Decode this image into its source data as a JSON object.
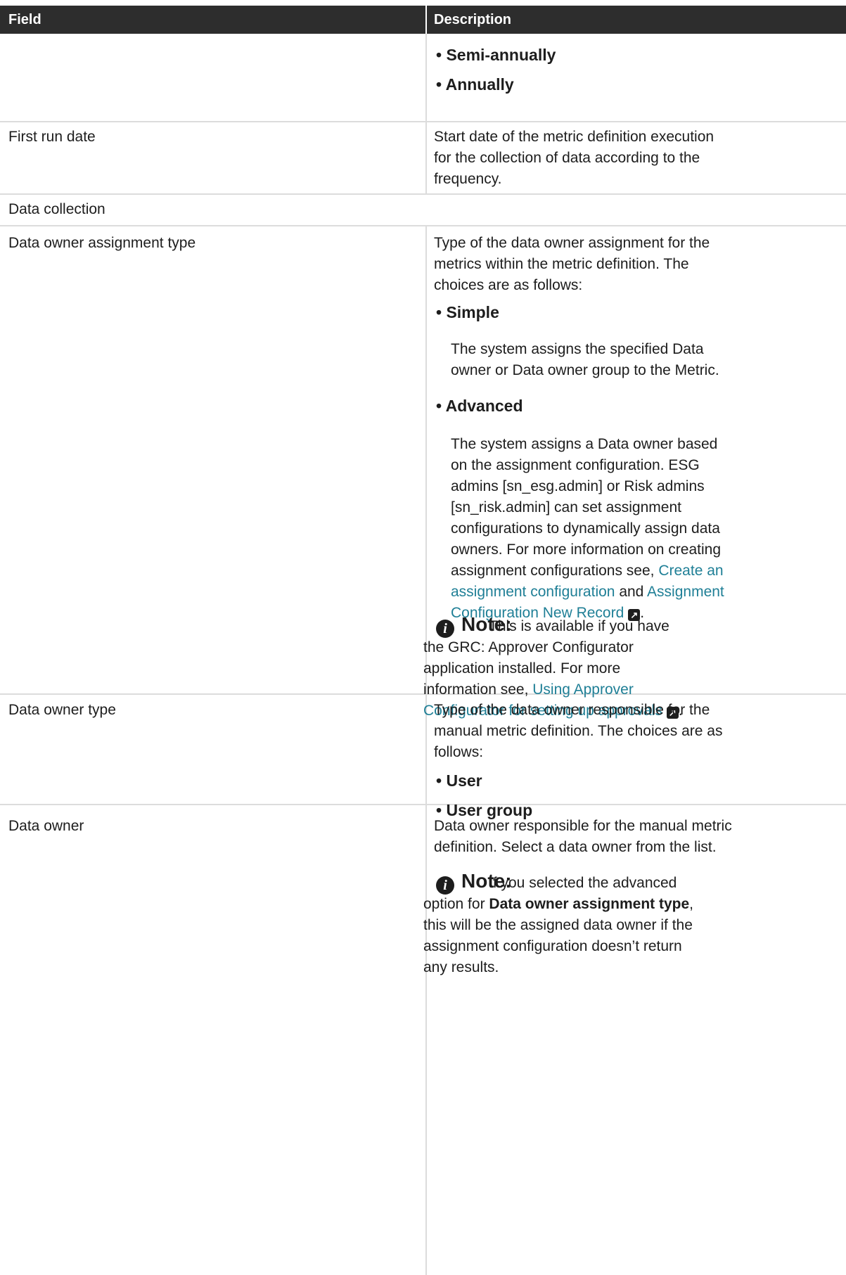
{
  "header": {
    "field": "Field",
    "description": "Description"
  },
  "row_frequency_tail": {
    "options": [
      "Semi-annually",
      "Annually"
    ]
  },
  "row_first_run": {
    "field": "First run date",
    "description_lines": [
      "Start date of the metric definition execution",
      "for the collection of data according to the",
      "frequency."
    ]
  },
  "section": {
    "label": "Data collection"
  },
  "row_assignment_type": {
    "field": "Data owner assignment type",
    "description_lines": [
      "Type of the data owner assignment for the",
      "metrics within the metric definition. The",
      "choices are as follows:"
    ],
    "option_simple": "Simple",
    "simple_lines": [
      "The system assigns the specified Data",
      "owner or Data owner group to the Metric."
    ],
    "option_advanced": "Advanced",
    "advanced_lines": [
      "The system assigns a Data owner based",
      "on the assignment configuration. ESG",
      "admins [sn_esg.admin] or Risk admins",
      "[sn_risk.admin] can set assignment",
      "configurations to dynamically assign data",
      "owners. For more information on creating"
    ],
    "advanced_link_line1_pre": "assignment configurations see, ",
    "advanced_link1_part1": "Create an",
    "advanced_link1_part2": "assignment configuration",
    "advanced_and": " and ",
    "advanced_link2_part1": "Assignment",
    "advanced_link2_part2": "Configuration New Record",
    "advanced_end": ".",
    "note_title": "Note:",
    "note_lines": [
      "This is available if you have",
      "the GRC: Approver Configurator",
      "application installed. For more",
      "information see, "
    ],
    "note_link_part1": "Using Approver",
    "note_link_part2": "Configurator for setting up approvals",
    "note_end": "."
  },
  "row_owner_type": {
    "field": "Data owner type",
    "description_lines": [
      "Type of the data owner responsible for the",
      "manual metric definition. The choices are as",
      "follows:"
    ],
    "options": [
      "User",
      "User group"
    ]
  },
  "row_owner": {
    "field": "Data owner",
    "description_lines": [
      "Data owner responsible for the manual metric",
      "definition. Select a data owner from the list."
    ],
    "note_title": "Note:",
    "note_line1": "If you selected the advanced",
    "note_line2_pre": "option for ",
    "note_line2_bold": "Data owner assignment type",
    "note_line2_post": ",",
    "note_lines_rest": [
      "this will be the assigned data owner if the",
      "assignment configuration doesn’t return",
      "any results."
    ]
  },
  "icons": {
    "note": "info-icon",
    "external": "external-link-icon"
  }
}
